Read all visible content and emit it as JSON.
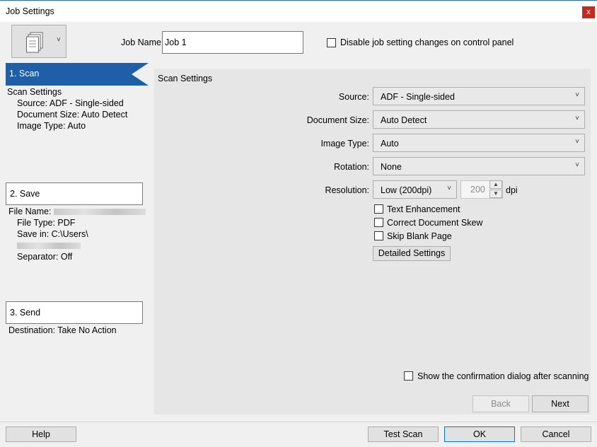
{
  "window": {
    "title": "Job Settings",
    "close_glyph": "x"
  },
  "top": {
    "job_name_label": "Job Name",
    "job_name_value": "Job 1",
    "disable_label": "Disable job setting changes on control panel",
    "icon": "document-stack-icon"
  },
  "steps": {
    "scan": {
      "label": "1. Scan",
      "section": "Scan Settings",
      "lines": [
        "Source: ADF - Single-sided",
        "Document Size: Auto Detect",
        "Image Type: Auto"
      ]
    },
    "save": {
      "label": "2. Save",
      "file_name_label": "File Name:",
      "file_type": "File Type: PDF",
      "save_in": "Save in: C:\\Users\\",
      "separator": "Separator: Off"
    },
    "send": {
      "label": "3. Send",
      "destination": "Destination: Take No Action"
    }
  },
  "panel": {
    "heading": "Scan Settings",
    "source": {
      "label": "Source:",
      "value": "ADF - Single-sided"
    },
    "document_size": {
      "label": "Document Size:",
      "value": "Auto Detect"
    },
    "image_type": {
      "label": "Image Type:",
      "value": "Auto"
    },
    "rotation": {
      "label": "Rotation:",
      "value": "None"
    },
    "resolution": {
      "label": "Resolution:",
      "value": "Low (200dpi)",
      "custom": "200",
      "unit": "dpi"
    },
    "options": [
      "Text Enhancement",
      "Correct Document Skew",
      "Skip Blank Page"
    ],
    "detailed_settings": "Detailed Settings",
    "confirm_label": "Show the confirmation dialog after scanning",
    "back": "Back",
    "next": "Next"
  },
  "footer": {
    "help": "Help",
    "test_scan": "Test Scan",
    "ok": "OK",
    "cancel": "Cancel"
  }
}
